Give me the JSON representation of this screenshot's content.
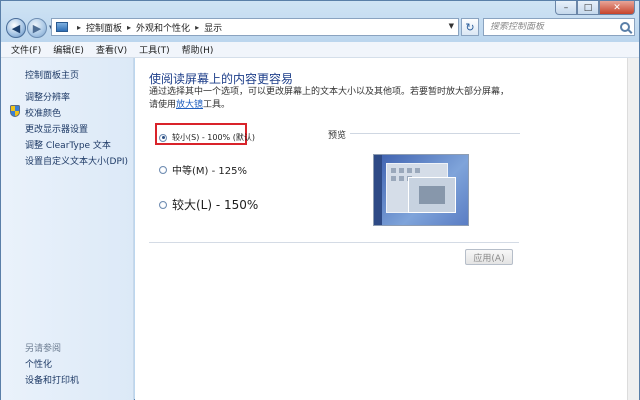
{
  "window": {
    "caption": {
      "minimize": "–",
      "maximize": "□",
      "close": "✕"
    }
  },
  "nav": {
    "back_icon": "arrow-left-icon",
    "forward_icon": "arrow-right-icon",
    "breadcrumbs": [
      "控制面板",
      "外观和个性化",
      "显示"
    ],
    "search_placeholder": "搜索控制面板"
  },
  "menu": {
    "items": [
      "文件(F)",
      "编辑(E)",
      "查看(V)",
      "工具(T)",
      "帮助(H)"
    ]
  },
  "sidebar": {
    "home": "控制面板主页",
    "links": [
      "调整分辨率",
      "校准颜色",
      "更改显示器设置",
      "调整 ClearType 文本",
      "设置自定义文本大小(DPI)"
    ],
    "see_also_label": "另请参阅",
    "see_also": [
      "个性化",
      "设备和打印机"
    ]
  },
  "main": {
    "heading": "使阅读屏幕上的内容更容易",
    "intro_text": "通过选择其中一个选项，可以更改屏幕上的文本大小以及其他项。若要暂时放大部分屏幕，请使用",
    "intro_link": "放大镜",
    "intro_tail": "工具。",
    "options": [
      {
        "label": "较小(S) - 100% (默认)",
        "checked": true
      },
      {
        "label": "中等(M) - 125%",
        "checked": false
      },
      {
        "label": "较大(L) - 150%",
        "checked": false
      }
    ],
    "preview_label": "预览",
    "apply_button": "应用(A)"
  }
}
